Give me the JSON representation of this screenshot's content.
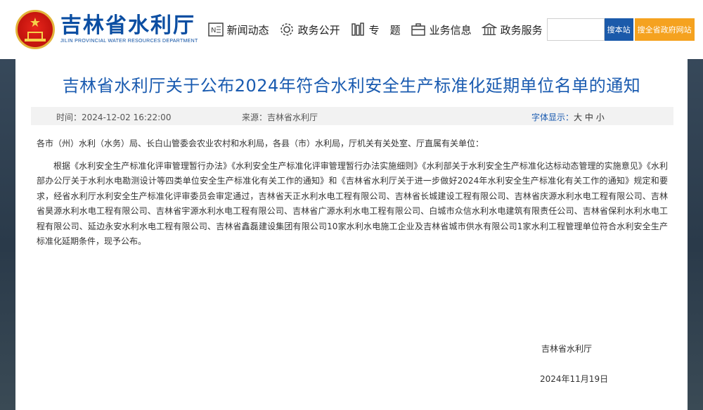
{
  "header": {
    "logo_cn": "吉林省水利厅",
    "logo_en": "JILIN PROVINCIAL WATER RESOURCES DEPARTMENT",
    "nav": [
      {
        "label": "新闻动态",
        "icon": "news-icon"
      },
      {
        "label": "政务公开",
        "icon": "gear-icon"
      },
      {
        "label": "专　题",
        "icon": "books-icon"
      },
      {
        "label": "业务信息",
        "icon": "briefcase-icon"
      },
      {
        "label": "政务服务",
        "icon": "government-building-icon"
      }
    ],
    "search_placeholder": "",
    "search_button": "搜本站",
    "search_all_button": "搜全省政府网站"
  },
  "article": {
    "title": "吉林省水利厅关于公布2024年符合水利安全生产标准化延期单位名单的通知",
    "meta": {
      "time": "时间：2024-12-02 16:22:00",
      "source": "来源：吉林省水利厅",
      "font_label": "字体显示：",
      "font_large": "大",
      "font_medium": "中",
      "font_small": "小"
    },
    "salutation": "各市（州）水利（水务）局、长白山管委会农业农村和水利局，各县（市）水利局，厅机关有关处室、厅直属有关单位：",
    "paragraph": "根据《水利安全生产标准化评审管理暂行办法》《水利安全生产标准化评审管理暂行办法实施细则》《水利部关于水利安全生产标准化达标动态管理的实施意见》《水利部办公厅关于水利水电勘测设计等四类单位安全生产标准化有关工作的通知》和《吉林省水利厅关于进一步做好2024年水利安全生产标准化有关工作的通知》规定和要求，经省水利厅水利安全生产标准化评审委员会审定通过，吉林省天正水利水电工程有限公司、吉林省长城建设工程有限公司、吉林省庆源水利水电工程有限公司、吉林省昊源水利水电工程有限公司、吉林省宇源水利水电工程有限公司、吉林省广源水利水电工程有限公司、白城市众信水利水电建筑有限责任公司、吉林省保利水利水电工程有限公司、延边永安水利水电工程有限公司、吉林省鑫磊建设集团有限公司10家水利水电施工企业及吉林省城市供水有限公司1家水利工程管理单位符合水利安全生产标准化延期条件，现予公布。",
    "sign_org": "吉林省水利厅",
    "sign_date": "2024年11月19日"
  },
  "colors": {
    "brand_blue": "#1a5bb0",
    "search_blue": "#1b5aaa",
    "search_orange": "#f5a21f"
  }
}
